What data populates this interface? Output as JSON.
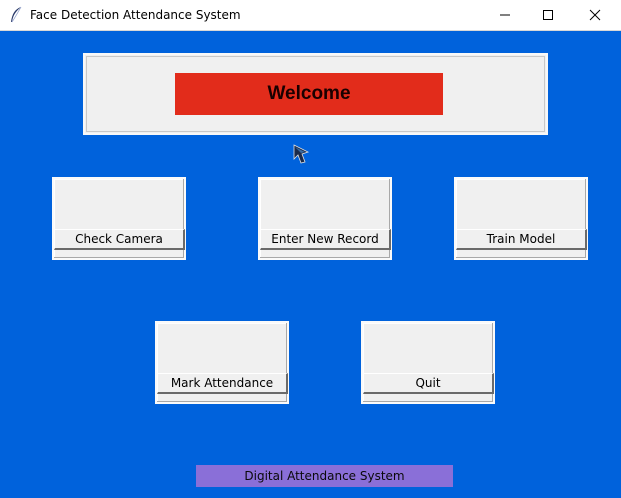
{
  "window": {
    "title": "Face Detection Attendance System",
    "app_icon": "feather-icon",
    "controls": [
      "minimize-icon",
      "maximize-icon",
      "close-icon"
    ]
  },
  "welcome": {
    "text": "Welcome",
    "color": "#e22c1b"
  },
  "buttons": {
    "check_camera": "Check Camera",
    "enter_new_record": "Enter New Record",
    "train_model": "Train Model",
    "mark_attendance": "Mark Attendance",
    "quit": "Quit"
  },
  "footer": {
    "text": "Digital Attendance System",
    "color": "#8a6fd8"
  },
  "colors": {
    "background": "#0062dc",
    "panel": "#f0f0f0"
  }
}
